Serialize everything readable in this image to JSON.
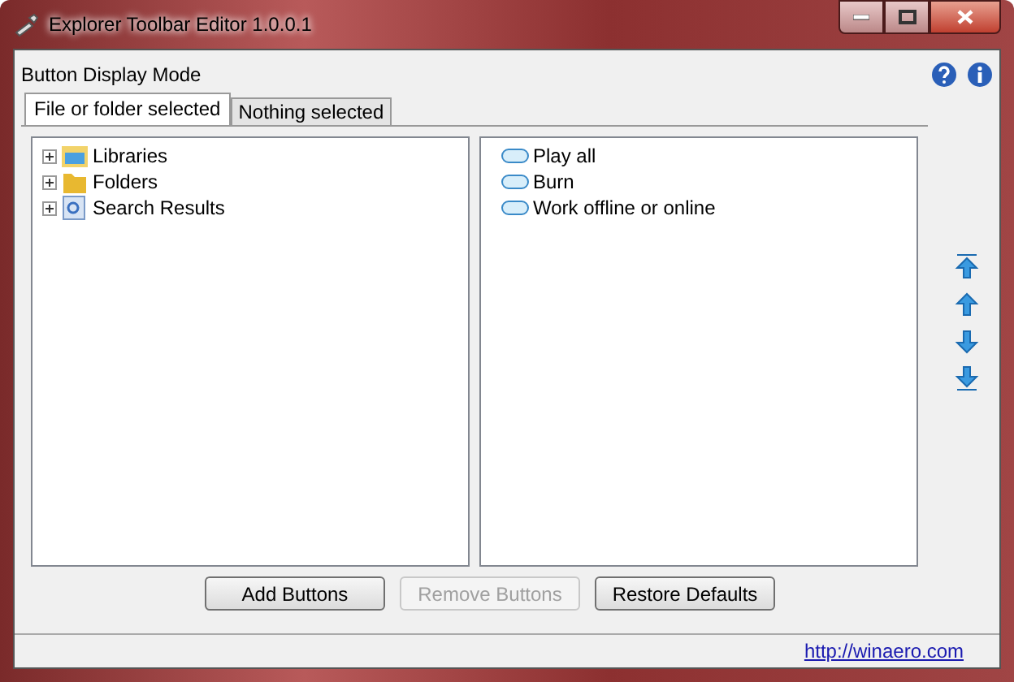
{
  "window": {
    "title": "Explorer Toolbar Editor 1.0.0.1"
  },
  "mode_label": "Button Display Mode",
  "tabs": [
    {
      "label": "File or folder selected",
      "selected": true
    },
    {
      "label": "Nothing selected",
      "selected": false
    }
  ],
  "tree": [
    {
      "label": "Libraries",
      "kind": "libraries",
      "expanded": false
    },
    {
      "label": "Folders",
      "kind": "folder",
      "expanded": false
    },
    {
      "label": "Search Results",
      "kind": "search",
      "expanded": false
    }
  ],
  "toolbar_buttons": [
    "Play all",
    "Burn",
    "Work offline or online"
  ],
  "buttons": [
    {
      "label": "Add Buttons",
      "disabled": false
    },
    {
      "label": "Remove Buttons",
      "disabled": true
    },
    {
      "label": "Restore Defaults",
      "disabled": false
    }
  ],
  "status_bar": {
    "link": "http://winaero.com"
  }
}
